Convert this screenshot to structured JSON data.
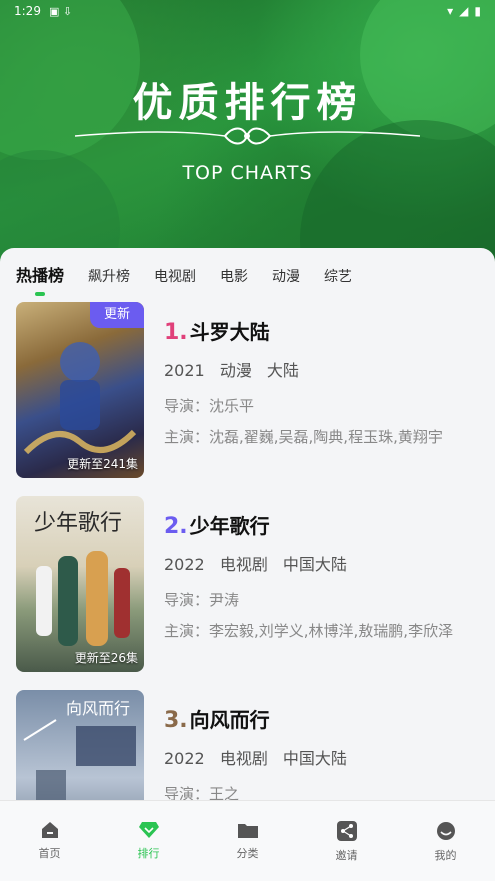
{
  "status_bar": {
    "time": "1:29"
  },
  "hero": {
    "title": "优质排行榜",
    "subtitle": "TOP CHARTS"
  },
  "tabs": [
    {
      "label": "热播榜",
      "active": true
    },
    {
      "label": "飙升榜"
    },
    {
      "label": "电视剧"
    },
    {
      "label": "电影"
    },
    {
      "label": "动漫"
    },
    {
      "label": "综艺"
    }
  ],
  "items": [
    {
      "rank": "1.",
      "rank_color": "#e0407a",
      "title": "斗罗大陆",
      "year": "2021",
      "genre": "动漫",
      "region": "大陆",
      "director": "导演：沈乐平",
      "cast": "主演：沈磊,翟巍,吴磊,陶典,程玉珠,黄翔宇",
      "badge": "更新",
      "update": "更新至241集"
    },
    {
      "rank": "2.",
      "rank_color": "#6b5cf0",
      "title": "少年歌行",
      "year": "2022",
      "genre": "电视剧",
      "region": "中国大陆",
      "director": "导演：尹涛",
      "cast": "主演：李宏毅,刘学义,林博洋,敖瑞鹏,李欣泽",
      "update": "更新至26集"
    },
    {
      "rank": "3.",
      "rank_color": "#8a6a4a",
      "title": "向风而行",
      "year": "2022",
      "genre": "电视剧",
      "region": "中国大陆",
      "director": "导演：王之"
    }
  ],
  "nav": [
    {
      "label": "首页",
      "icon": "home-icon"
    },
    {
      "label": "排行",
      "icon": "diamond-icon",
      "active": true
    },
    {
      "label": "分类",
      "icon": "folder-icon"
    },
    {
      "label": "邀请",
      "icon": "share-icon"
    },
    {
      "label": "我的",
      "icon": "profile-icon"
    }
  ],
  "colors": {
    "accent": "#2bc452",
    "badge": "#6b5cf0"
  }
}
